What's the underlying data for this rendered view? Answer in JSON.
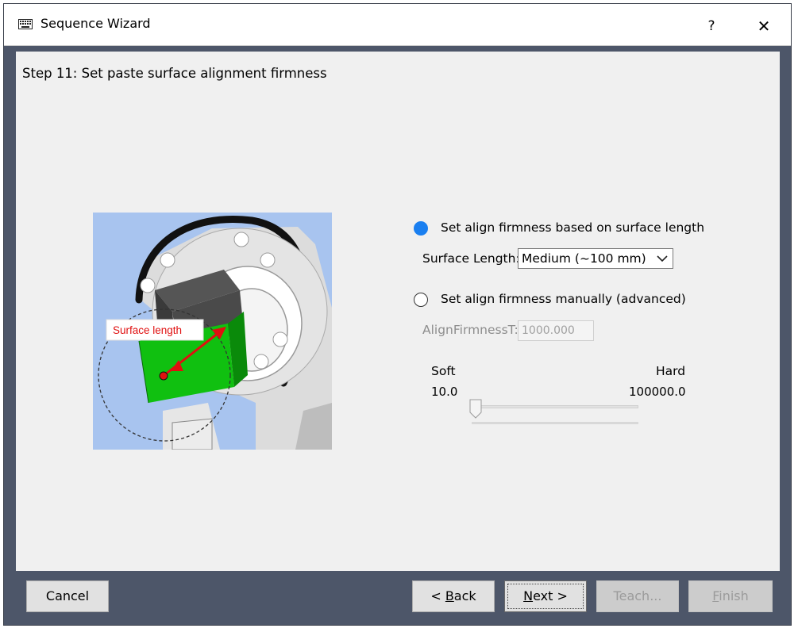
{
  "window": {
    "title": "Sequence Wizard",
    "help_label": "?",
    "close_label": "✕"
  },
  "step_title": "Step 11: Set paste surface alignment firmness",
  "illustration": {
    "label": "Surface length"
  },
  "options": {
    "option1_label": "Set align firmness based on surface length",
    "option1_selected": true,
    "option2_label": "Set align firmness manually (advanced)",
    "option2_selected": false
  },
  "surface_length": {
    "label": "Surface Length:",
    "value": "Medium (~100 mm)"
  },
  "align_firmness": {
    "label": "AlignFirmnessT:",
    "value": "1000.000"
  },
  "slider": {
    "min_label": "Soft",
    "max_label": "Hard",
    "min_value": "10.0",
    "max_value": "100000.0",
    "position": 0
  },
  "buttons": {
    "cancel": "Cancel",
    "back_prefix": "< ",
    "back_key": "B",
    "back_rest": "ack",
    "next_key": "N",
    "next_rest": "ext >",
    "teach": "Teach...",
    "finish_key": "F",
    "finish_rest": "inish"
  },
  "colors": {
    "accent": "#1a7ff0",
    "footer": "#4d5669",
    "content_bg": "#f0f0f0",
    "block_green": "#10c010",
    "arrow_red": "#e01010"
  },
  "icons": {
    "app": "keyboard-icon",
    "close": "close-icon",
    "dropdown": "chevron-down-icon",
    "slider": "slider-thumb"
  }
}
